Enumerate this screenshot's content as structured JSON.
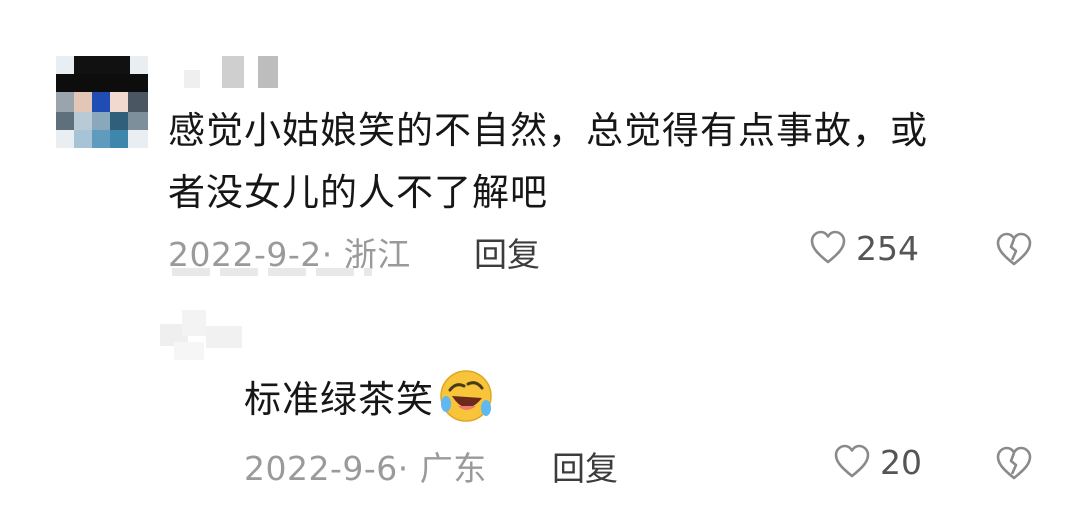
{
  "comment": {
    "text_line1": "感觉小姑娘笑的不自然，总觉得有点事故，或",
    "text_line2": "者没女儿的人不了解吧",
    "date_location": "2022-9-2· 浙江",
    "reply_label": "回复",
    "likes": "254"
  },
  "reply": {
    "text": "标准绿茶笑",
    "emoji": "rolling-on-floor-laughing-emoji",
    "date_location": "2022-9-6· 广东",
    "reply_label": "回复",
    "likes": "20"
  },
  "colors": {
    "text": "#161616",
    "meta": "#9a9a9a",
    "icon": "#8a8a8a",
    "emoji_yellow": "#f7c43a",
    "emoji_tear": "#5fb8f0"
  }
}
